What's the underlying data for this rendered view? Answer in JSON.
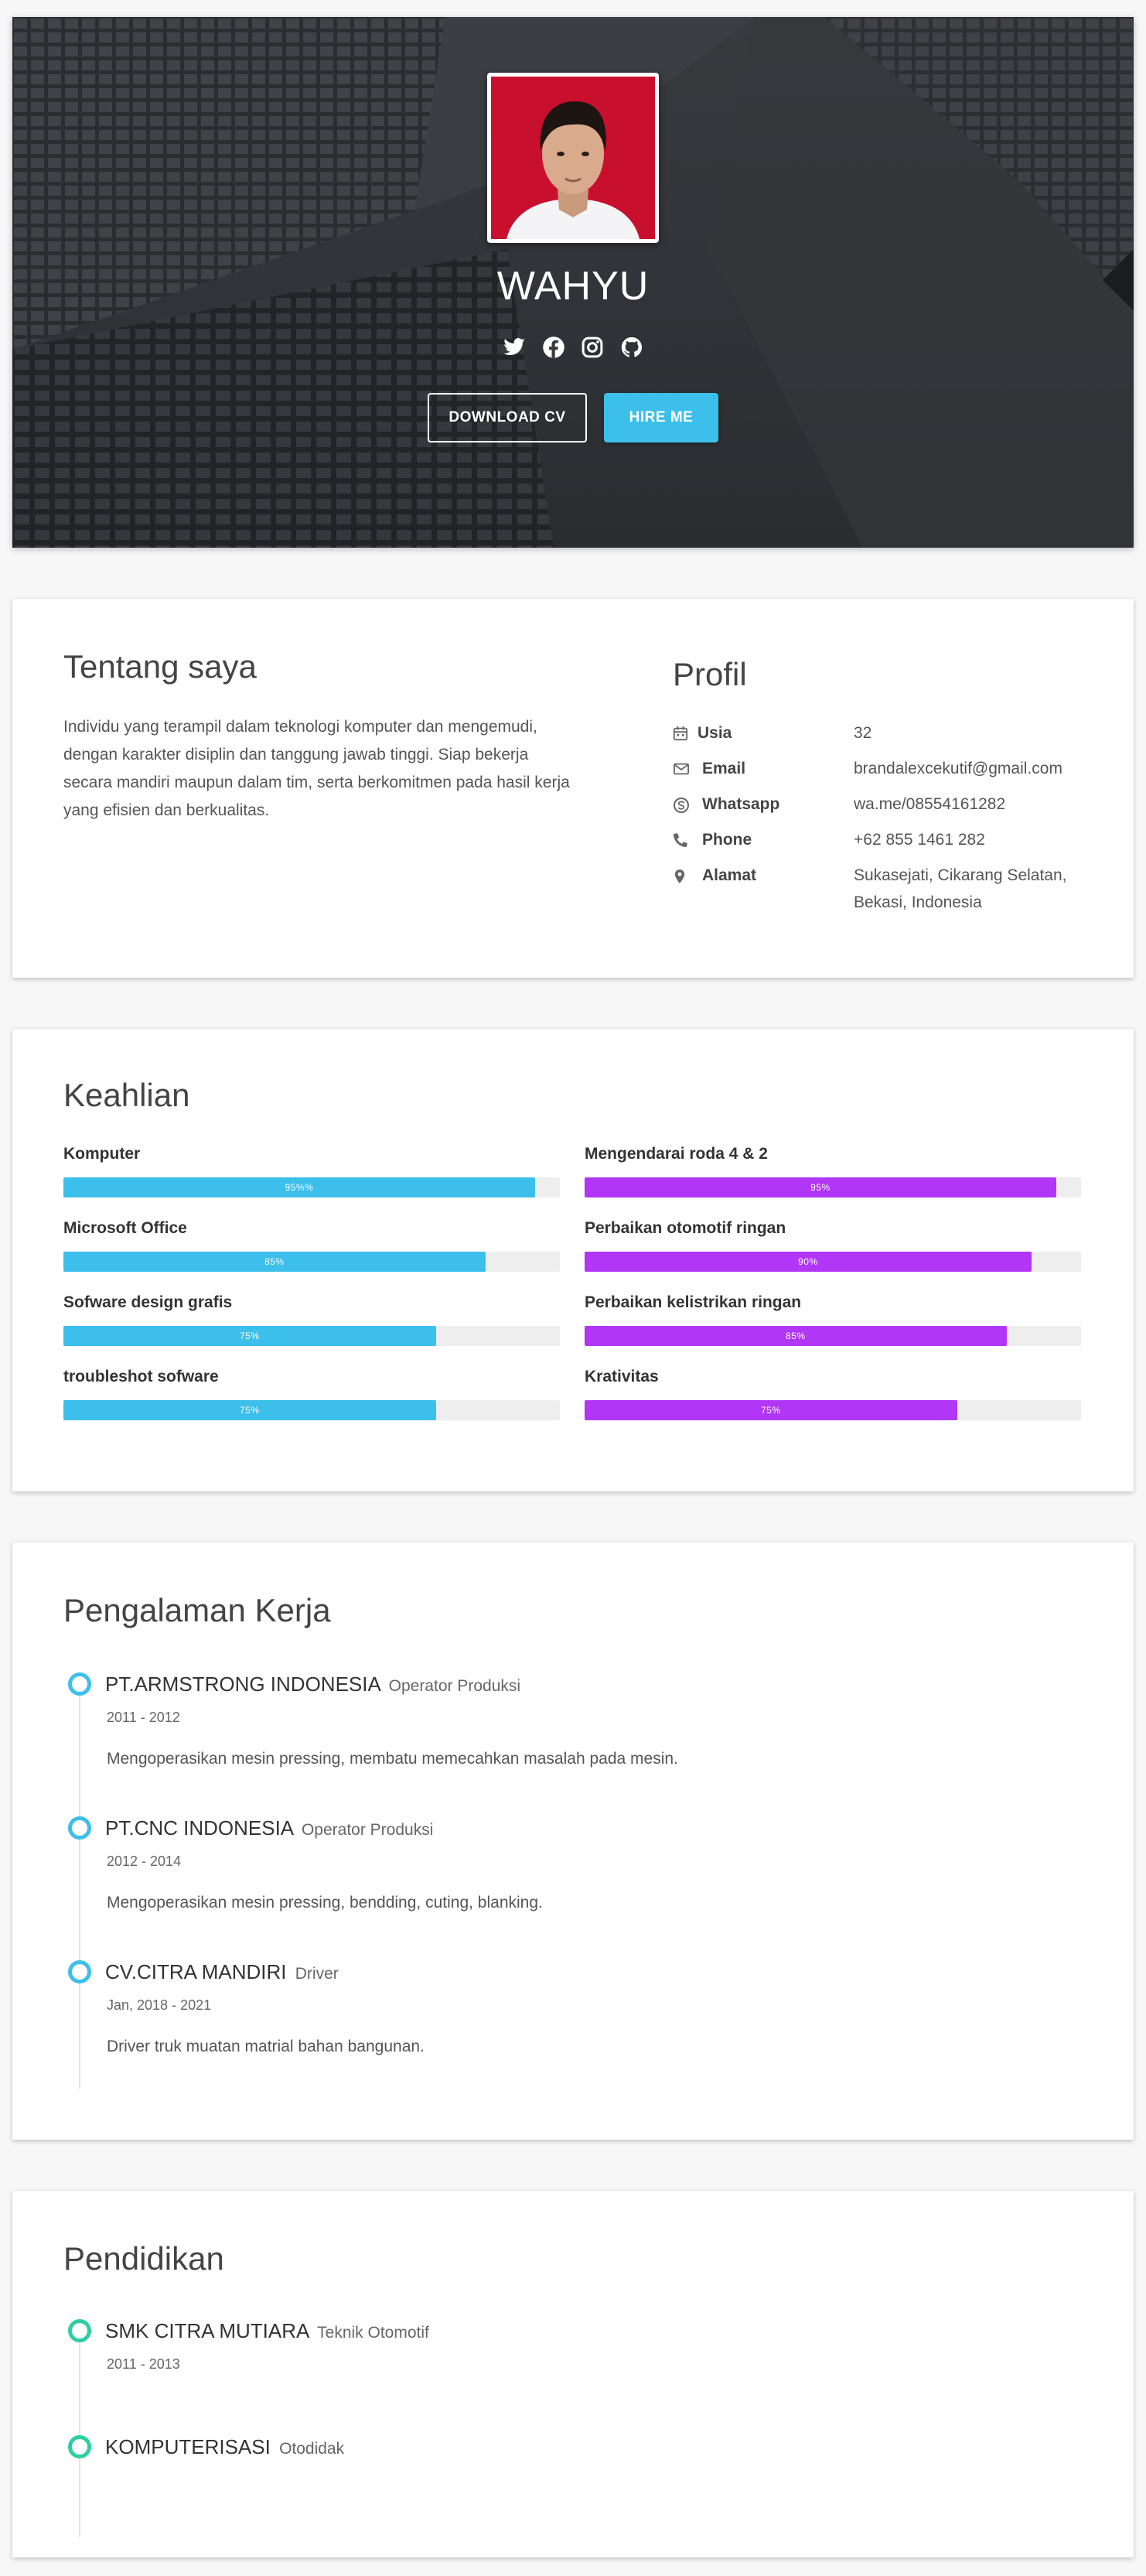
{
  "hero": {
    "name": "WAHYU",
    "social": [
      "twitter-icon",
      "facebook-icon",
      "instagram-icon",
      "github-icon"
    ],
    "download_label": "DOWNLOAD CV",
    "hire_label": "HIRE ME"
  },
  "about": {
    "title": "Tentang saya",
    "text": "Individu yang terampil dalam teknologi komputer dan mengemudi, dengan karakter disiplin dan tanggung jawab tinggi. Siap bekerja secara mandiri maupun dalam tim, serta berkomitmen pada hasil kerja yang efisien dan berkualitas."
  },
  "profil": {
    "title": "Profil",
    "rows": [
      {
        "icon": "calendar-icon",
        "label": "Usia",
        "value": "32"
      },
      {
        "icon": "envelope-icon",
        "label": "Email",
        "value": "brandalexcekutif@gmail.com"
      },
      {
        "icon": "skype-icon",
        "label": "Whatsapp",
        "value": "wa.me/08554161282"
      },
      {
        "icon": "phone-icon",
        "label": "Phone",
        "value": "+62 855 1461 282"
      },
      {
        "icon": "map-marker-icon",
        "label": "Alamat",
        "value": "Sukasejati, Cikarang Selatan, Bekasi, Indonesia"
      }
    ]
  },
  "skills": {
    "title": "Keahlian",
    "left": [
      {
        "name": "Komputer",
        "percent_label": "95%%",
        "level": 95
      },
      {
        "name": "Microsoft Office",
        "percent_label": "85%",
        "level": 85
      },
      {
        "name": "Sofware design grafis",
        "percent_label": "75%",
        "level": 75
      },
      {
        "name": "troubleshot sofware",
        "percent_label": "75%",
        "level": 75
      }
    ],
    "right": [
      {
        "name": "Mengendarai roda 4 & 2",
        "percent_label": "95%",
        "level": 95
      },
      {
        "name": "Perbaikan otomotif ringan",
        "percent_label": "90%",
        "level": 90
      },
      {
        "name": "Perbaikan kelistrikan ringan",
        "percent_label": "85%",
        "level": 85
      },
      {
        "name": "Krativitas",
        "percent_label": "75%",
        "level": 75
      }
    ],
    "colors": {
      "left": "#3cbfeb",
      "right": "#b236f5",
      "track": "#eeeeee"
    }
  },
  "experience": {
    "title": "Pengalaman Kerja",
    "items": [
      {
        "company": "PT.ARMSTRONG INDONESIA",
        "role": "Operator Produksi",
        "date": "2011 - 2012",
        "desc": "Mengoperasikan mesin pressing, membatu memecahkan masalah pada mesin."
      },
      {
        "company": "PT.CNC INDONESIA",
        "role": "Operator Produksi",
        "date": "2012 - 2014",
        "desc": "Mengoperasikan mesin pressing, bendding, cuting, blanking."
      },
      {
        "company": "CV.CITRA MANDIRI",
        "role": "Driver",
        "date": "Jan, 2018 - 2021",
        "desc": "Driver truk muatan matrial bahan bangunan."
      }
    ]
  },
  "education": {
    "title": "Pendidikan",
    "items": [
      {
        "school": "SMK CITRA MUTIARA",
        "major": "Teknik Otomotif",
        "date": "2011 - 2013"
      },
      {
        "school": "KOMPUTERISASI",
        "major": "Otodidak",
        "date": ""
      }
    ]
  }
}
